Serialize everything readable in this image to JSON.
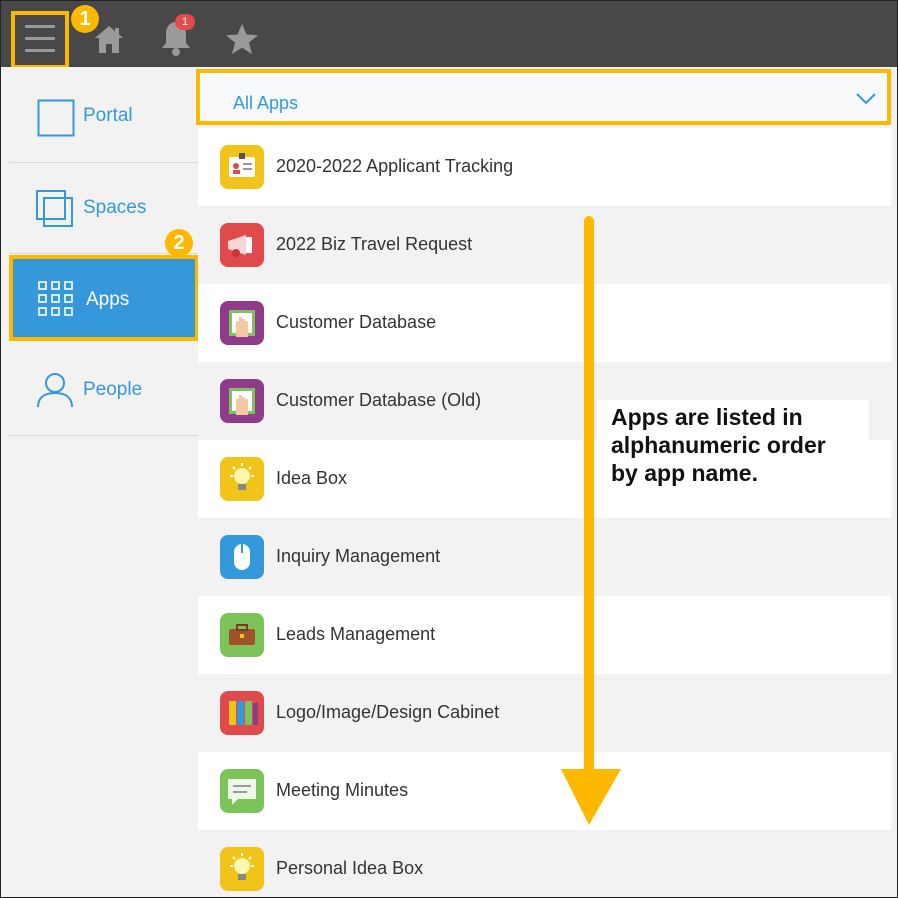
{
  "topbar": {
    "menu_button": "main-menu",
    "home_button": "home",
    "notifications": {
      "count": "1"
    },
    "favorites_button": "favorites",
    "callout_1": "1"
  },
  "sidebar": {
    "items": [
      {
        "label": "Portal",
        "icon": "portal-icon"
      },
      {
        "label": "Spaces",
        "icon": "spaces-icon"
      },
      {
        "label": "Apps",
        "icon": "apps-grid-icon",
        "active": true
      },
      {
        "label": "People",
        "icon": "person-icon"
      }
    ],
    "callout_2": "2"
  },
  "apps_filter": {
    "selected": "All Apps"
  },
  "app_list": [
    {
      "name": "2020-2022 Applicant Tracking",
      "icon": "id-badge-icon",
      "color": "#f0c419"
    },
    {
      "name": "2022 Biz Travel Request",
      "icon": "megaphone-icon",
      "color": "#e04a4a"
    },
    {
      "name": "Customer Database",
      "icon": "hand-card-icon",
      "color": "#8e3b8a"
    },
    {
      "name": "Customer Database (Old)",
      "icon": "hand-card-icon",
      "color": "#8e3b8a"
    },
    {
      "name": "Idea Box",
      "icon": "lightbulb-icon",
      "color": "#f0c419"
    },
    {
      "name": "Inquiry Management",
      "icon": "mouse-icon",
      "color": "#3498db"
    },
    {
      "name": "Leads Management",
      "icon": "briefcase-icon",
      "color": "#7cc35a"
    },
    {
      "name": "Logo/Image/Design Cabinet",
      "icon": "binders-icon",
      "color": "#e04a4a"
    },
    {
      "name": "Meeting Minutes",
      "icon": "chat-bubble-icon",
      "color": "#7cc35a"
    },
    {
      "name": "Personal Idea Box",
      "icon": "lightbulb-icon",
      "color": "#f0c419"
    }
  ],
  "annotation": {
    "lines": [
      "Apps are listed in",
      "alphanumeric order",
      "by app name."
    ]
  },
  "colors": {
    "accent": "#fcb900",
    "link_blue": "#3498db",
    "topbar": "#484848"
  }
}
